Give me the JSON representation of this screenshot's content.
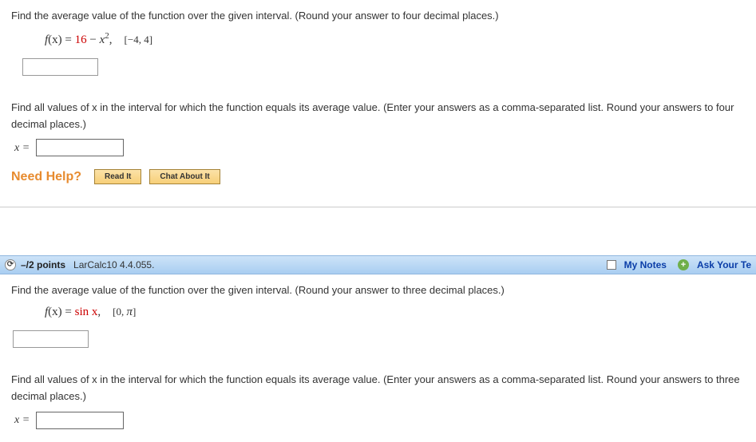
{
  "q1": {
    "prompt1": "Find the average value of the function over the given interval. (Round your answer to four decimal places.)",
    "func_lhs": "f",
    "func_paren_x": "(x)",
    "eq": " = ",
    "c1": "16",
    "minus": " − ",
    "xvar": "x",
    "exp": "2",
    "comma_sp": ", ",
    "interval": "[−4, 4]",
    "prompt2": "Find all values of x in the interval for which the function equals its average value. (Enter your answers as a comma-separated list. Round your answers to four decimal places.)",
    "x_label": "x =",
    "need_help": "Need Help?",
    "read_it": "Read It",
    "chat_about_it": "Chat About It"
  },
  "q2": {
    "header": {
      "expand_glyph": "⟳",
      "points": "–/2 points",
      "source": "LarCalc10 4.4.055.",
      "my_notes": "My Notes",
      "plus_glyph": "+",
      "ask": "Ask Your Te"
    },
    "prompt1": "Find the average value of the function over the given interval. (Round your answer to three decimal places.)",
    "func_lhs": "f",
    "func_paren_x": "(x)",
    "eq": " = ",
    "sinx": "sin x",
    "comma_sp": ", ",
    "interval_open": "[0, ",
    "pi": "π",
    "interval_close": "]",
    "prompt2": "Find all values of x in the interval for which the function equals its average value. (Enter your answers as a comma-separated list. Round your answers to three decimal places.)",
    "x_label": "x ="
  }
}
